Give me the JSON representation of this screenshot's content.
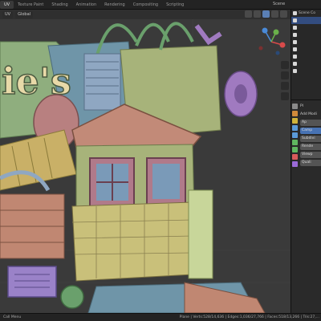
{
  "menu": {
    "tabs": [
      "UV",
      "Texture Paint",
      "Shading",
      "Animation",
      "Rendering",
      "Compositing",
      "Scripting"
    ],
    "scene": "Scene"
  },
  "viewport": {
    "header": {
      "editor": "UV",
      "orientation": "Global"
    },
    "model_sign_text": "ie's"
  },
  "outliner": {
    "header": "Scene Co",
    "rows": [
      {
        "label": "Scene Co",
        "selected": false
      },
      {
        "label": "",
        "selected": true
      },
      {
        "label": "",
        "selected": false
      },
      {
        "label": "",
        "selected": false
      },
      {
        "label": "",
        "selected": false
      },
      {
        "label": "",
        "selected": false
      },
      {
        "label": "",
        "selected": false
      },
      {
        "label": "",
        "selected": false
      },
      {
        "label": "",
        "selected": false
      }
    ]
  },
  "properties": {
    "object_field": "Pl",
    "add_modifier": "Add Modi",
    "buttons": [
      "Ap",
      "Camp",
      "Subdivi",
      "Rende",
      "Viewp",
      "Quali"
    ],
    "tab_colors": [
      "#8a8a8a",
      "#d08a3a",
      "#d0b33a",
      "#5a9ad8",
      "#5a9ad8",
      "#5fb55f",
      "#5fb55f",
      "#d85a5a",
      "#9a6ad8"
    ]
  },
  "status": {
    "left": "Call Menu",
    "right": "Plane | Verts:528/14,636 | Edges:1,036/27,766 | Faces:518/13,266 | Tris:27,..."
  },
  "colors": {
    "accent": "#4772b3",
    "viewport_bg": "#3a3a3a"
  }
}
